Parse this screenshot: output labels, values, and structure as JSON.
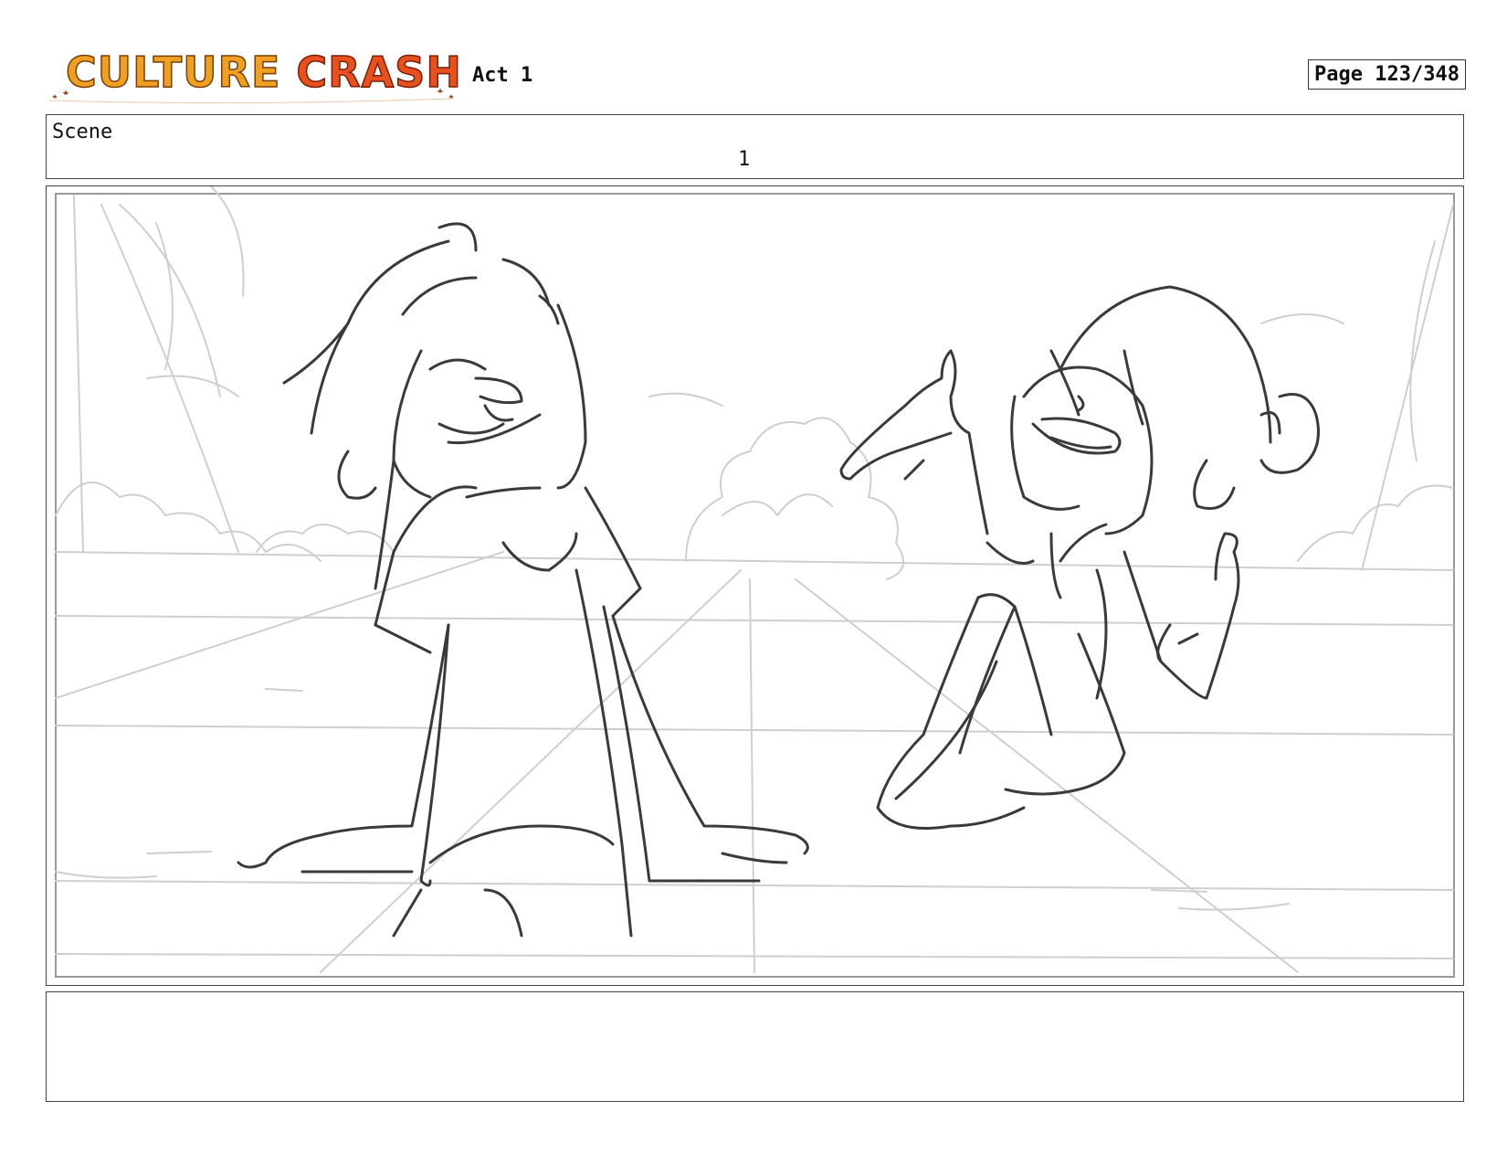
{
  "header": {
    "logo": {
      "word1": "CULTURE",
      "word2": "CRASH"
    },
    "act_label": "Act 1",
    "page_label": "Page 123/348"
  },
  "scene": {
    "label": "Scene",
    "number": "1"
  },
  "panel": {
    "description_icon": "storyboard-sketch"
  },
  "notes": {
    "text": ""
  },
  "colors": {
    "logo_orange": "#f0a020",
    "logo_red": "#e8501e",
    "sketch_line": "#333333",
    "background_line": "#c8c8c8"
  }
}
